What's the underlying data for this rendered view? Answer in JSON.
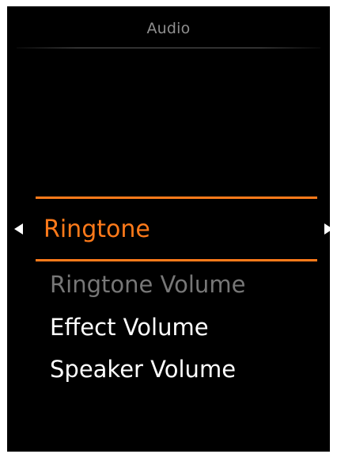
{
  "header": {
    "title": "Audio"
  },
  "selector": {
    "value": "Ringtone",
    "left_arrow_icon": "triangle-left-icon",
    "right_arrow_icon": "triangle-right-icon",
    "accent_color": "#ff7a1a"
  },
  "menu": {
    "items": [
      {
        "label": "Ringtone Volume",
        "state": "disabled"
      },
      {
        "label": "Effect Volume",
        "state": "enabled"
      },
      {
        "label": "Speaker Volume",
        "state": "enabled"
      }
    ]
  },
  "colors": {
    "background": "#000000",
    "accent": "#ff7a1a",
    "text": "#ffffff",
    "disabled_text": "#777777",
    "title_text": "#8e8e8e"
  }
}
